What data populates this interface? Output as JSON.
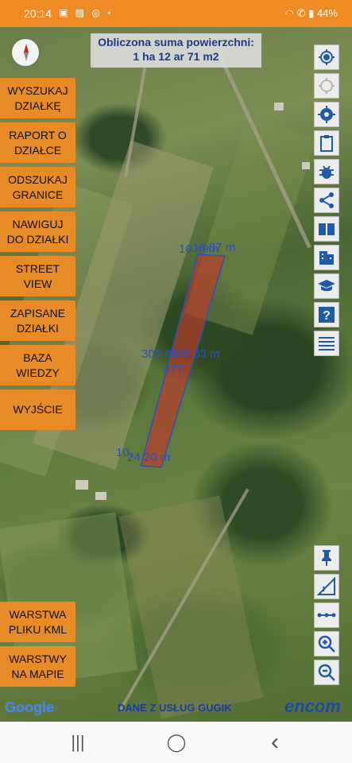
{
  "status_bar": {
    "time": "20:14",
    "left_icons": [
      "video-call-icon",
      "gallery-icon",
      "whatsapp-icon",
      "dot-icon"
    ],
    "battery": "44%",
    "right_icons": [
      "wifi-icon",
      "wifi-call-icon",
      "signal-icon"
    ]
  },
  "header": {
    "line1": "Obliczona suma powierzchni:",
    "line2": "1 ha 12 ar 71 m2"
  },
  "left_menu": [
    {
      "name": "btn-wyszukaj-dzialke",
      "label": "WYSZUKAJ\nDZIAŁKĘ"
    },
    {
      "name": "btn-raport-o-dzialce",
      "label": "RAPORT O\nDZIAŁCE"
    },
    {
      "name": "btn-odszukaj-granice",
      "label": "ODSZUKAJ\nGRANICE"
    },
    {
      "name": "btn-nawiguj-do-dzialki",
      "label": "NAWIGUJ\nDO DZIAŁKI"
    },
    {
      "name": "btn-street-view",
      "label": "STREET\nVIEW"
    },
    {
      "name": "btn-zapisane-dzialki",
      "label": "ZAPISANE\nDZIAŁKI"
    },
    {
      "name": "btn-baza-wiedzy",
      "label": "BAZA\nWIEDZY"
    },
    {
      "name": "btn-wyjscie",
      "label": "WYJŚCIE"
    }
  ],
  "bottom_left_menu": [
    {
      "name": "btn-warstwa-pliku-kml",
      "label": "WARSTWA\nPLIKU KML"
    },
    {
      "name": "btn-warstwy-na-mapie",
      "label": "WARSTWY\nNA MAPIE"
    }
  ],
  "right_toolbar": [
    "locate-icon",
    "gps-off-icon",
    "settings-icon",
    "clipboard-icon",
    "bug-icon",
    "share-icon",
    "book-icon",
    "building-icon",
    "school-icon",
    "help-icon",
    "list-icon"
  ],
  "bottom_right_toolbar": [
    "pin-icon",
    "measure-angle-icon",
    "measure-line-icon",
    "zoom-in-icon",
    "zoom-out-icon"
  ],
  "parcel": {
    "top_label_a": "16.87 m",
    "top_label_b": "10.49m",
    "side_label_a": "307,66",
    "side_label_b": "328,33 m",
    "plot_id": "477",
    "bottom_label_a": "10.",
    "bottom_label_b": "24,20 m"
  },
  "footer": {
    "google": "Google",
    "source": "DANE Z USŁUG GUGIK",
    "brand": "encom"
  },
  "colors": {
    "status_bar": "#f08a24",
    "menu_button": "#e68b25",
    "header_text": "#1d3a8a",
    "parcel_fill": "#c0392b",
    "parcel_outline": "#2a53b9"
  },
  "nav_bar": {
    "recent": "|||",
    "home": "◯",
    "back": "‹"
  }
}
